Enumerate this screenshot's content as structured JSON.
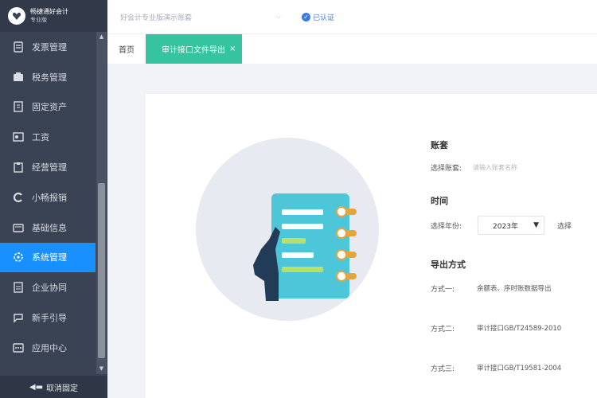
{
  "app": {
    "logo_title": "畅捷通好会计",
    "logo_subtitle": "专业版"
  },
  "sidebar": {
    "items": [
      {
        "label": "发票管理",
        "icon": "invoice-icon",
        "active": false
      },
      {
        "label": "税务管理",
        "icon": "tax-icon",
        "active": false
      },
      {
        "label": "固定资产",
        "icon": "asset-icon",
        "active": false
      },
      {
        "label": "工资",
        "icon": "salary-icon",
        "active": false
      },
      {
        "label": "经营管理",
        "icon": "operation-icon",
        "active": false
      },
      {
        "label": "小畅报销",
        "icon": "reimburse-icon",
        "active": false
      },
      {
        "label": "基础信息",
        "icon": "basic-info-icon",
        "active": false
      },
      {
        "label": "系统管理",
        "icon": "system-icon",
        "active": true
      },
      {
        "label": "企业协同",
        "icon": "collaboration-icon",
        "active": false
      },
      {
        "label": "新手引导",
        "icon": "guide-icon",
        "active": false
      },
      {
        "label": "应用中心",
        "icon": "app-center-icon",
        "active": false
      }
    ],
    "footer_label": "取消固定"
  },
  "topbar": {
    "org_placeholder": "好会计专业版演示账套",
    "verified_label": "已认证"
  },
  "tabs": [
    {
      "label": "首页",
      "active": false
    },
    {
      "label": "审计接口文件导出",
      "active": true
    }
  ],
  "form": {
    "account_set": {
      "title": "账套",
      "label": "选择账套:",
      "placeholder": "请输入账套名称"
    },
    "time": {
      "title": "时间",
      "label": "选择年份:",
      "year": "2023年",
      "extra_label": "选择"
    },
    "export": {
      "title": "导出方式",
      "options": [
        {
          "label": "方式一:",
          "desc": "余额表、序时账数据导出"
        },
        {
          "label": "方式二:",
          "desc": "审计接口GB/T24589-2010"
        },
        {
          "label": "方式三:",
          "desc": "审计接口GB/T19581-2004"
        }
      ]
    }
  },
  "colors": {
    "sidebar_bg": "#3a4354",
    "active_nav": "#1890ff",
    "active_tab": "#36c3a0",
    "illustration_circle": "#e7eaf0",
    "notebook": "#4ec6d9",
    "rings": "#e5a53b",
    "hand": "#223b57"
  }
}
